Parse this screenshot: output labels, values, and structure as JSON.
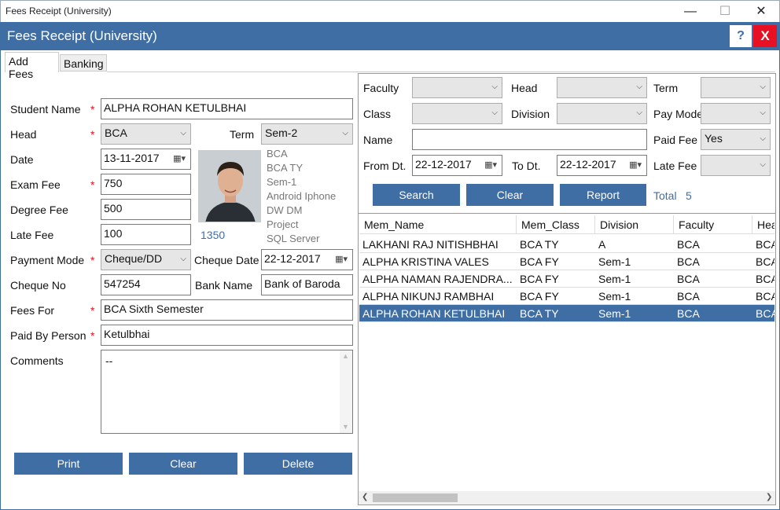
{
  "window": {
    "title": "Fees Receipt (University)",
    "min": "—",
    "max": "☐",
    "close": "✕"
  },
  "app": {
    "title": "Fees Receipt (University)",
    "help": "?",
    "close": "X"
  },
  "tabs": [
    "Add Fees",
    "Banking"
  ],
  "form": {
    "student_name_label": "Student Name",
    "student_name": "ALPHA ROHAN KETULBHAI",
    "head_label": "Head",
    "head": "BCA",
    "term_label": "Term",
    "term": "Sem-2",
    "date_label": "Date",
    "date": "13-11-2017",
    "exam_fee_label": "Exam Fee",
    "exam_fee": "750",
    "degree_fee_label": "Degree Fee",
    "degree_fee": "500",
    "late_fee_label": "Late Fee",
    "late_fee": "100",
    "payment_mode_label": "Payment Mode",
    "payment_mode": "Cheque/DD",
    "cheque_date_label": "Cheque Date",
    "cheque_date": "22-12-2017",
    "cheque_no_label": "Cheque No",
    "cheque_no": "547254",
    "bank_name_label": "Bank Name",
    "bank_name": "Bank of Baroda",
    "fees_for_label": "Fees For",
    "fees_for": "BCA Sixth Semester",
    "paid_by_label": "Paid By Person",
    "paid_by": "Ketulbhai",
    "comments_label": "Comments",
    "comments": "--",
    "required": "*",
    "total_amount": "1350",
    "info": [
      "BCA",
      "BCA TY",
      "Sem-1",
      "Android  Iphone",
      "DW  DM",
      "Project",
      "SQL Server"
    ],
    "buttons": {
      "print": "Print",
      "clear": "Clear",
      "delete": "Delete"
    }
  },
  "filter": {
    "faculty_label": "Faculty",
    "head_label": "Head",
    "term_label": "Term",
    "class_label": "Class",
    "division_label": "Division",
    "pay_mode_label": "Pay Mode",
    "name_label": "Name",
    "paid_fee_label": "Paid Fee",
    "paid_fee": "Yes",
    "from_label": "From Dt.",
    "from_date": "22-12-2017",
    "to_label": "To Dt.",
    "to_date": "22-12-2017",
    "late_fee_label": "Late Fee",
    "search": "Search",
    "clear": "Clear",
    "report": "Report",
    "total_label": "Total",
    "total": "5"
  },
  "grid": {
    "columns": [
      "Mem_Name",
      "Mem_Class",
      "Division",
      "Faculty",
      "Hea"
    ],
    "rows": [
      [
        "LAKHANI RAJ NITISHBHAI",
        "BCA TY",
        "A",
        "BCA",
        "BCA"
      ],
      [
        "ALPHA KRISTINA VALES",
        "BCA FY",
        "Sem-1",
        "BCA",
        "BCA"
      ],
      [
        "ALPHA NAMAN RAJENDRA...",
        "BCA FY",
        "Sem-1",
        "BCA",
        "BCA"
      ],
      [
        "ALPHA NIKUNJ RAMBHAI",
        "BCA FY",
        "Sem-1",
        "BCA",
        "BCA"
      ],
      [
        "ALPHA ROHAN KETULBHAI",
        "BCA TY",
        "Sem-1",
        "BCA",
        "BCA"
      ]
    ],
    "selected_index": 4
  },
  "colors": {
    "accent": "#3f6ea5",
    "required": "#e81123"
  }
}
